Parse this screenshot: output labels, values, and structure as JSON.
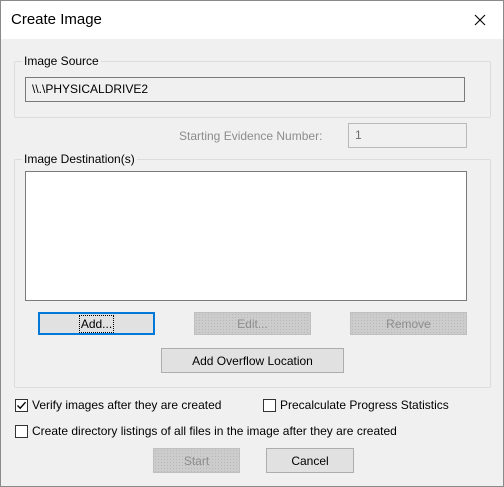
{
  "window": {
    "title": "Create Image",
    "close_icon": "close-icon"
  },
  "image_source": {
    "label": "Image Source",
    "value": "\\\\.\\PHYSICALDRIVE2"
  },
  "starting_evidence": {
    "label": "Starting Evidence Number:",
    "value": "1"
  },
  "image_destination": {
    "label": "Image Destination(s)",
    "items": [],
    "buttons": {
      "add": "Add...",
      "edit": "Edit...",
      "remove": "Remove",
      "add_overflow": "Add Overflow Location"
    }
  },
  "options": {
    "verify": {
      "label": "Verify images after they are created",
      "checked": true
    },
    "precalculate": {
      "label": "Precalculate Progress Statistics",
      "checked": false
    },
    "directory_listings": {
      "label": "Create directory listings of all files in the image after they are created",
      "checked": false
    }
  },
  "footer": {
    "start": "Start",
    "cancel": "Cancel"
  },
  "colors": {
    "title_bar": "#ffffff",
    "dialog_bg": "#f0f0f0",
    "focus_border": "#0078d7",
    "disabled_text": "#8c8c8c"
  }
}
